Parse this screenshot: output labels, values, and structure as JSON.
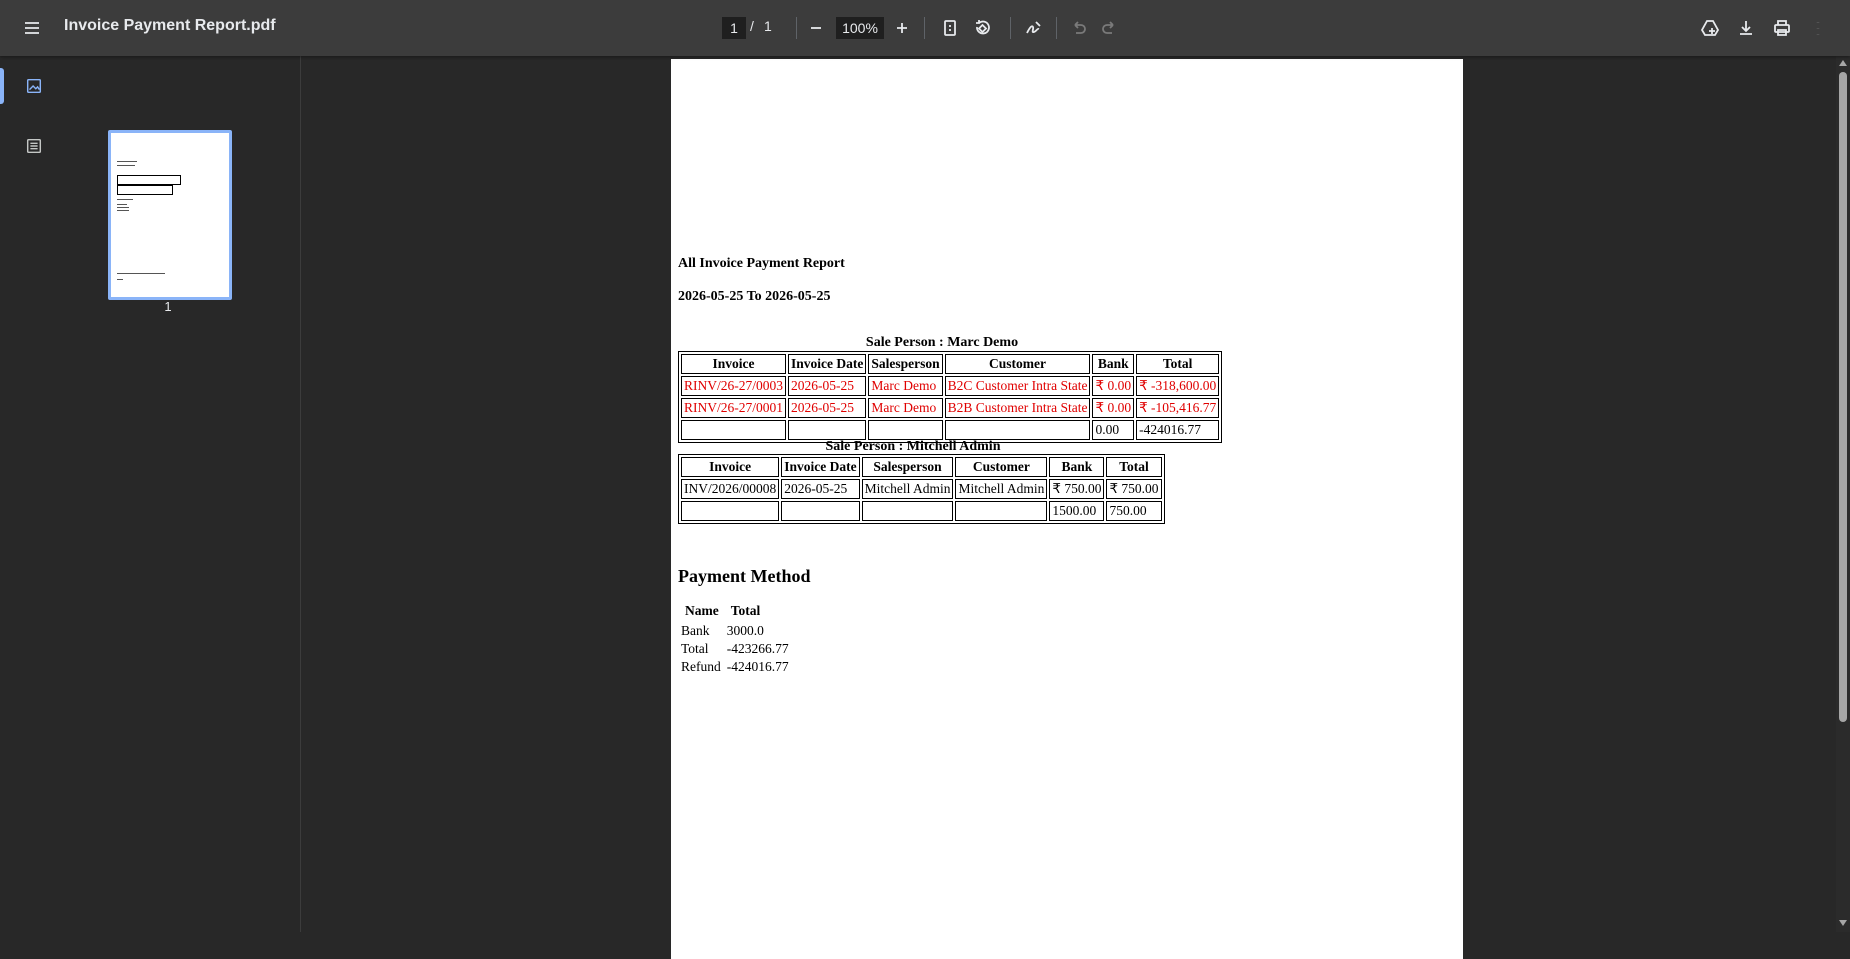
{
  "toolbar": {
    "title": "Invoice Payment Report.pdf",
    "page_current": "1",
    "page_separator": "/",
    "page_total": "1",
    "zoom": "100%"
  },
  "sidebar": {
    "thumbnail_page": "1"
  },
  "report": {
    "title": "All Invoice Payment Report",
    "date_range": "2026-05-25 To 2026-05-25",
    "headers": [
      "Invoice",
      "Invoice Date",
      "Salesperson",
      "Customer",
      "Bank",
      "Total"
    ],
    "groups": [
      {
        "caption": "Sale Person : Marc Demo",
        "rows": [
          [
            "RINV/26-27/0003",
            "2026-05-25",
            "Marc Demo",
            "B2C Customer Intra State",
            "₹ 0.00",
            "₹ -318,600.00"
          ],
          [
            "RINV/26-27/0001",
            "2026-05-25",
            "Marc Demo",
            "B2B Customer Intra State",
            "₹ 0.00",
            "₹ -105,416.77"
          ]
        ],
        "totals": [
          "",
          "",
          "",
          "",
          "0.00",
          "-424016.77"
        ]
      },
      {
        "caption": "Sale Person : Mitchell Admin",
        "rows": [
          [
            "INV/2026/00008",
            "2026-05-25",
            "Mitchell Admin",
            "Mitchell Admin",
            "₹ 750.00",
            "₹ 750.00"
          ]
        ],
        "totals": [
          "",
          "",
          "",
          "",
          "1500.00",
          "750.00"
        ]
      }
    ],
    "payment_method": {
      "title": "Payment Method",
      "headers": [
        "Name",
        "Total"
      ],
      "rows": [
        [
          "Bank",
          "3000.0"
        ],
        [
          "Total",
          "-423266.77"
        ],
        [
          "Refund",
          "-424016.77"
        ]
      ]
    }
  },
  "colors": {
    "toolbar_bg": "#3c3c3c",
    "viewer_bg": "#282828",
    "accent": "#8ab4f8",
    "refund_red": "#e00000"
  }
}
